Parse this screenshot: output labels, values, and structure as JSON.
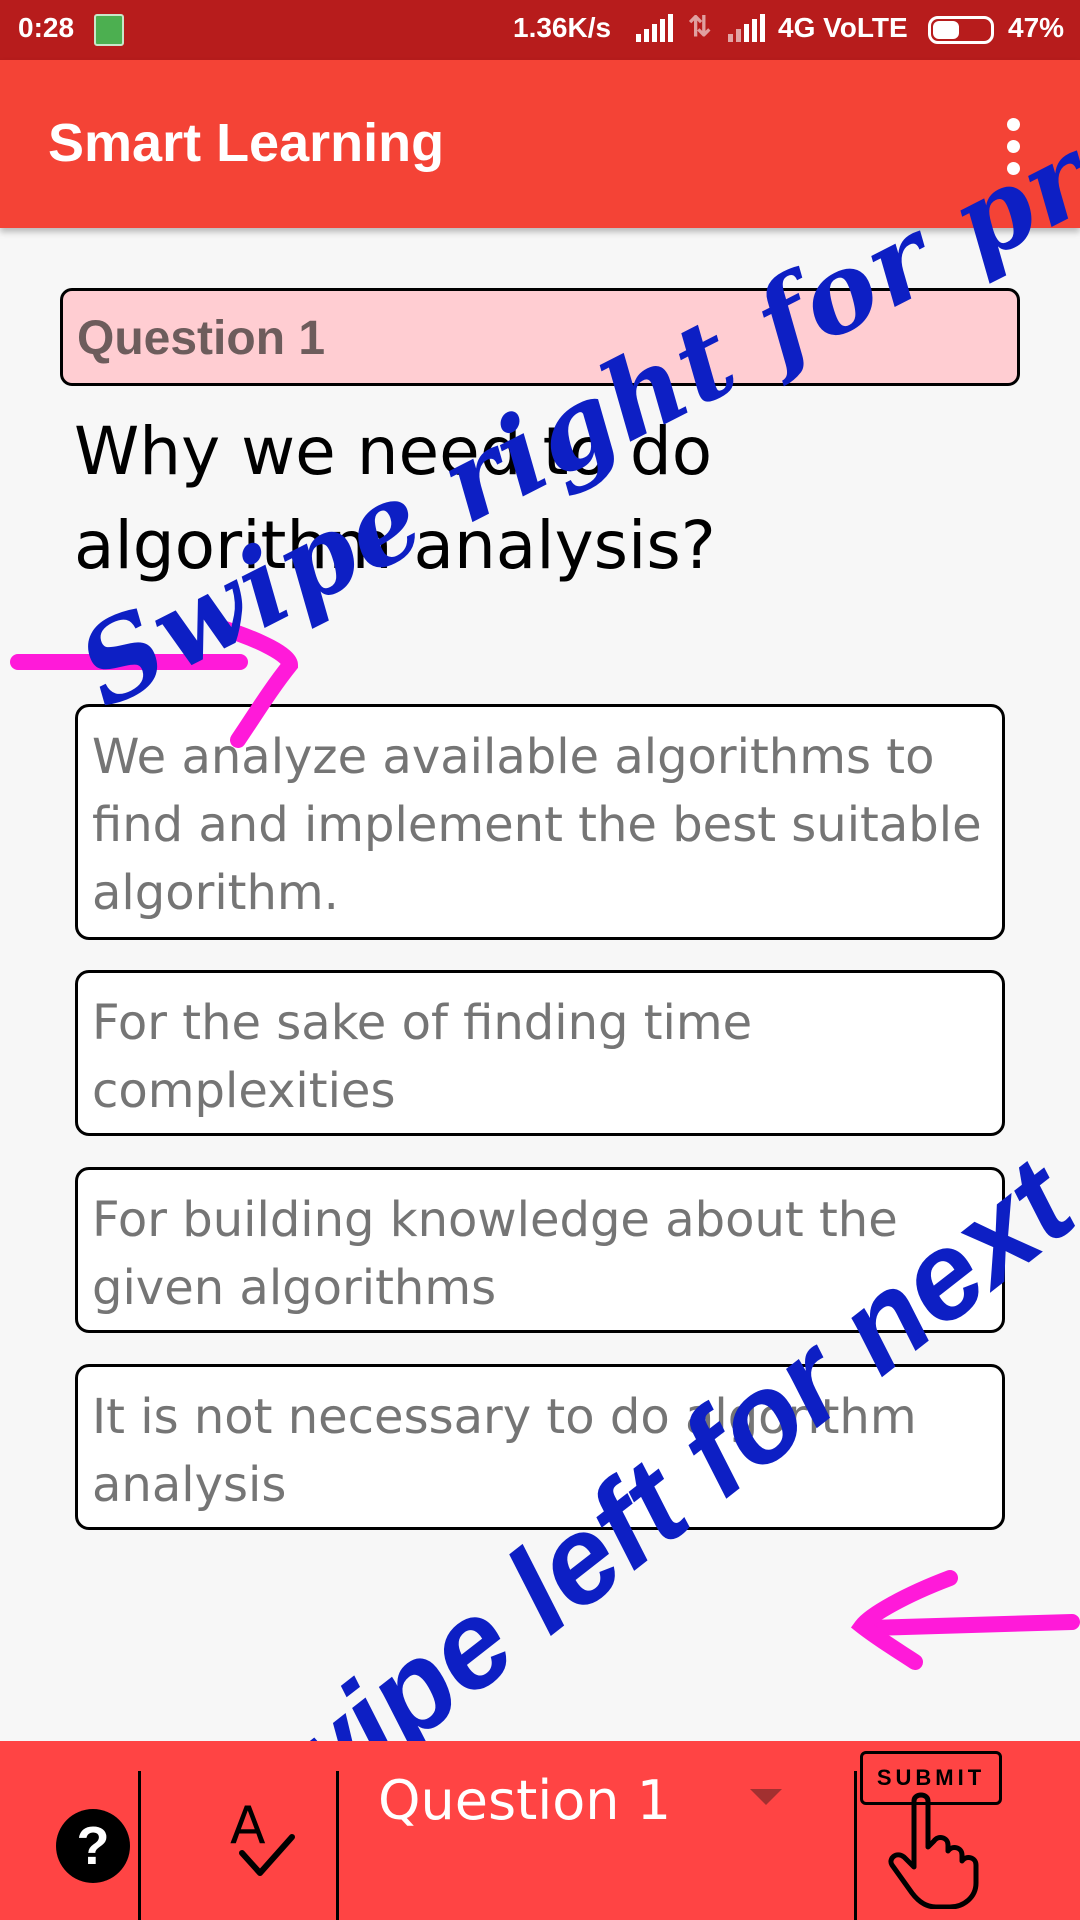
{
  "status_bar": {
    "time": "0:28",
    "speed": "1.36K/s",
    "network": "4G VoLTE",
    "battery": "47%",
    "battery_level": 0.47
  },
  "app_bar": {
    "title": "Smart Learning",
    "menu_icon": "more-vert-icon"
  },
  "question": {
    "header": "Question 1",
    "text": "Why we need to do algorithm analysis?"
  },
  "options": [
    "We analyze available algorithms to find and implement the best suitable algorithm.",
    "For the sake of finding time complexities",
    "For building knowledge about the given algorithms",
    "It is not necessary to do algorithm analysis"
  ],
  "hints": {
    "previous": "Swipe right for previous",
    "next": "Swipe left for next"
  },
  "bottom_bar": {
    "help_label": "?",
    "spell_icon": "spellcheck-icon",
    "question_select": "Question 1",
    "submit_label": "SUBMIT"
  },
  "colors": {
    "status_bar": "#b71c1c",
    "app_bar": "#f44336",
    "bottom_bar": "#ff4444",
    "question_header_bg": "#ffcdd2",
    "hint_text": "#0d1fc4",
    "arrow": "#ff1ad9"
  }
}
